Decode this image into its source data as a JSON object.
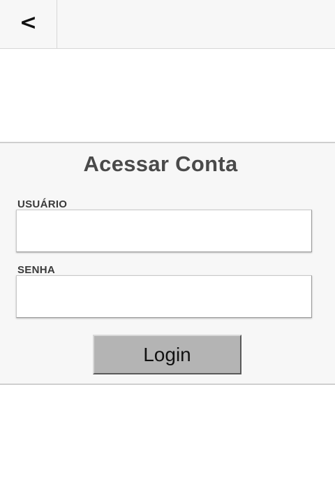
{
  "header": {
    "back_label": "<"
  },
  "login": {
    "title": "Acessar Conta",
    "username_label": "USUÁRIO",
    "username_value": "",
    "password_label": "SENHA",
    "password_value": "",
    "submit_label": "Login"
  },
  "colors": {
    "panel_background": "#f7f7f7",
    "button_background": "#b4b4b4",
    "title_text": "#4a4a4a"
  }
}
